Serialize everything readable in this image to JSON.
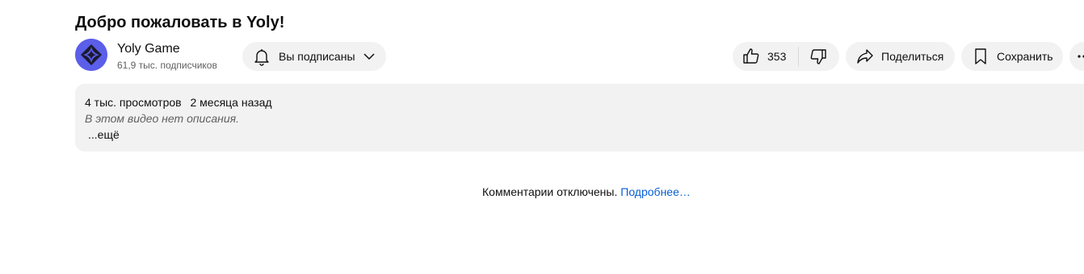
{
  "video": {
    "title": "Добро пожаловать в Yoly!"
  },
  "owner": {
    "avatar_icon": "channel-logo-icon",
    "channel_name": "Yoly Game",
    "subscribers": "61,9 тыс. подписчиков",
    "subscribe_button": {
      "label": "Вы подписаны",
      "icon": "bell-icon"
    }
  },
  "actions": {
    "like_count": "353",
    "like_icon": "thumb-up-icon",
    "dislike_icon": "thumb-down-icon",
    "share_label": "Поделиться",
    "share_icon": "share-icon",
    "save_label": "Сохранить",
    "save_icon": "bookmark-icon",
    "more_icon": "more-horizontal-icon"
  },
  "description": {
    "views": "4 тыс. просмотров",
    "date": "2 месяца назад",
    "empty_text": "В этом видео нет описания.",
    "more_label": "...ещё"
  },
  "comments": {
    "disabled_text": "Комментарии отключены.",
    "learn_more": "Подробнее…"
  },
  "colors": {
    "accent_link": "#065fd4",
    "avatar_bg": "#5b5ee8",
    "pill_bg": "#f2f2f2"
  }
}
